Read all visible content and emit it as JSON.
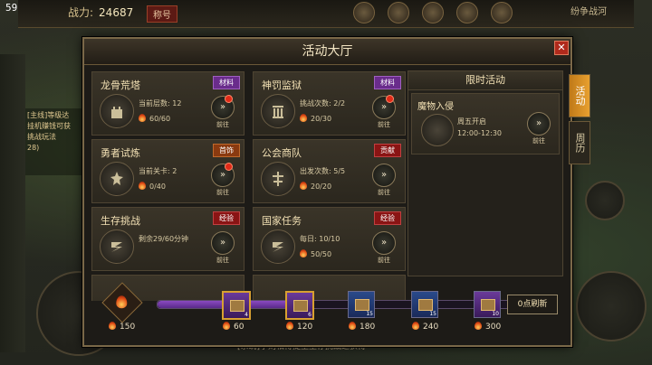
{
  "hud": {
    "fps": "59.8",
    "power_label": "战力:",
    "power_value": "24687",
    "rank_label": "称号",
    "top_right": "纷争战河",
    "chat_lines": [
      "[主线]等级达",
      "挂机赚钱可获",
      "挑战玩法",
      "28)"
    ],
    "bottom_msg": "[系统]李则相得提至生存挑战之获得"
  },
  "dialog": {
    "title": "活动大厅",
    "close_icon": "close-icon",
    "cards": [
      {
        "name": "龙骨荒塔",
        "tag": "材料",
        "tag_color": "purple",
        "line1": "当前层数: 12",
        "line2": "60/60",
        "go": "前往",
        "reddot": true,
        "icon": "tower-icon"
      },
      {
        "name": "神罚监狱",
        "tag": "材料",
        "tag_color": "purple",
        "line1": "挑战次数: 2/2",
        "line2": "20/30",
        "go": "前往",
        "reddot": true,
        "icon": "prison-icon"
      },
      {
        "name": "勇者试炼",
        "tag": "首饰",
        "tag_color": "orange",
        "line1": "当前关卡: 2",
        "line2": "0/40",
        "go": "前往",
        "reddot": true,
        "icon": "trial-icon"
      },
      {
        "name": "公会商队",
        "tag": "贡献",
        "tag_color": "red",
        "line1": "出发次数: 5/5",
        "line2": "20/20",
        "go": "前往",
        "reddot": false,
        "icon": "caravan-icon"
      },
      {
        "name": "生存挑战",
        "tag": "经验",
        "tag_color": "red",
        "line1": "剩余29/60分钟",
        "line2": "",
        "go": "前往",
        "reddot": false,
        "icon": "survival-icon"
      },
      {
        "name": "国家任务",
        "tag": "经验",
        "tag_color": "red",
        "line1": "每日: 10/10",
        "line2": "50/50",
        "go": "前往",
        "reddot": false,
        "icon": "nation-icon"
      }
    ],
    "limited": {
      "header": "限时活动",
      "item": {
        "name": "魔物入侵",
        "line1": "周五开启",
        "line2": "12:00-12:30",
        "go": "前往"
      }
    },
    "tabs": [
      "活动",
      "周历"
    ],
    "progress": {
      "points": "150",
      "fill_fraction": 0.44,
      "chests": [
        {
          "threshold": "60",
          "count": "4",
          "style": "gold"
        },
        {
          "threshold": "120",
          "count": "6",
          "style": "gold"
        },
        {
          "threshold": "180",
          "count": "15",
          "style": "blue"
        },
        {
          "threshold": "240",
          "count": "15",
          "style": "blue"
        },
        {
          "threshold": "300",
          "count": "10",
          "style": "purple"
        }
      ],
      "refresh": "0点刷新"
    }
  }
}
